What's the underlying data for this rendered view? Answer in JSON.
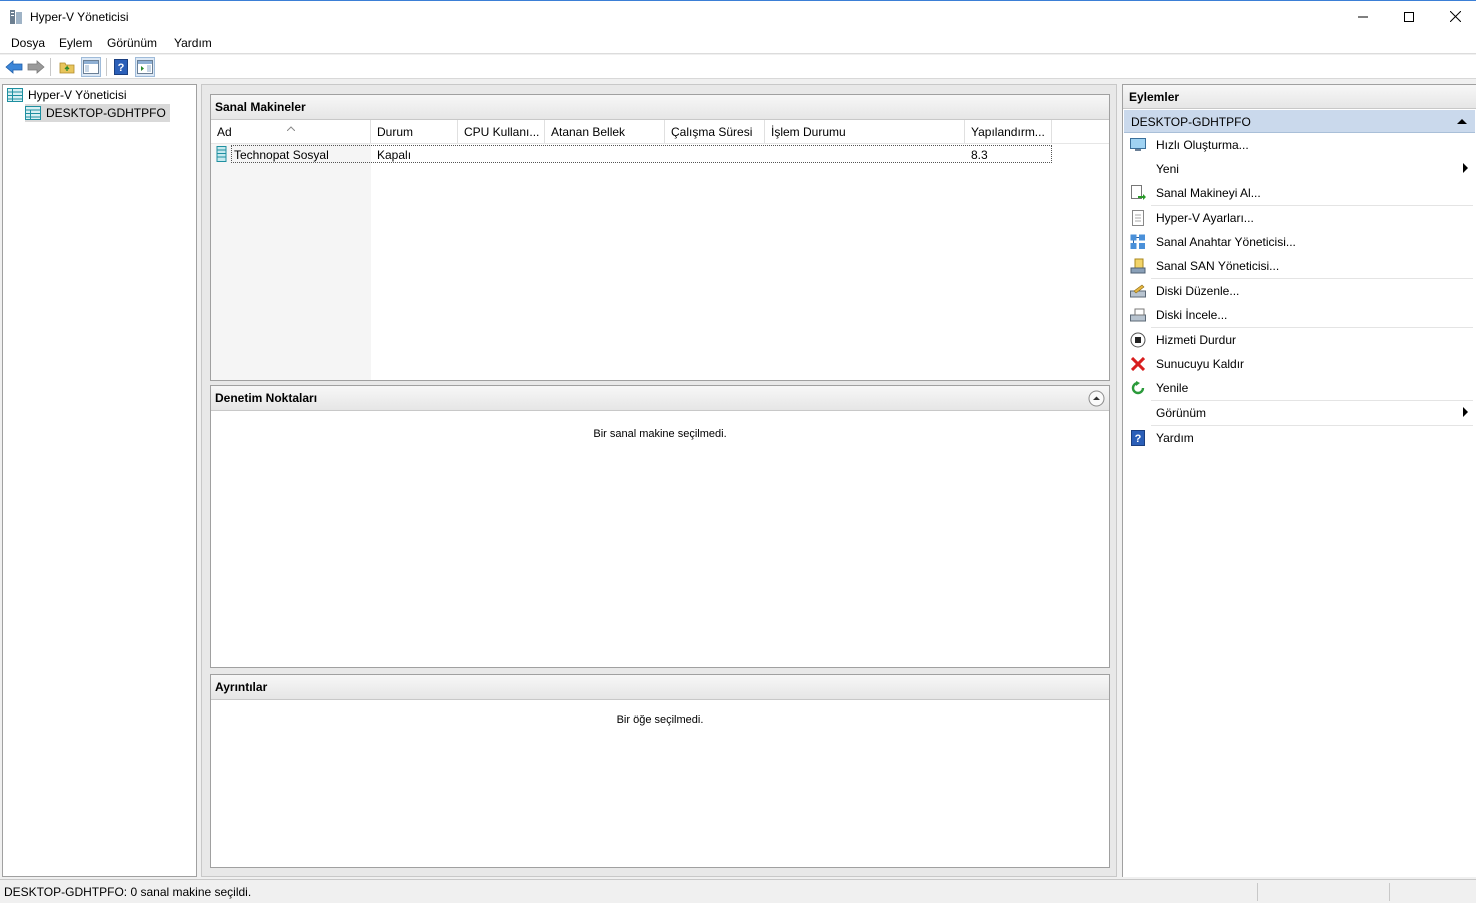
{
  "window": {
    "title": "Hyper-V Yöneticisi"
  },
  "menu": {
    "items": [
      "Dosya",
      "Eylem",
      "Görünüm",
      "Yardım"
    ]
  },
  "tree": {
    "root": "Hyper-V Yöneticisi",
    "host": "DESKTOP-GDHTPFO"
  },
  "vms": {
    "title": "Sanal Makineler",
    "columns": [
      "Ad",
      "Durum",
      "CPU Kullanı...",
      "Atanan Bellek",
      "Çalışma Süresi",
      "İşlem Durumu",
      "Yapılandırm..."
    ],
    "rows": [
      {
        "name": "Technopat Sosyal",
        "state": "Kapalı",
        "cpu": "",
        "memory": "",
        "uptime": "",
        "status": "",
        "version": "8.3"
      }
    ]
  },
  "checkpoints": {
    "title": "Denetim Noktaları",
    "empty": "Bir sanal makine seçilmedi."
  },
  "details": {
    "title": "Ayrıntılar",
    "empty": "Bir öğe seçilmedi."
  },
  "actions": {
    "title": "Eylemler",
    "section": "DESKTOP-GDHTPFO",
    "items": [
      {
        "label": "Hızlı Oluşturma...",
        "icon": "quick-create-icon"
      },
      {
        "label": "Yeni",
        "icon": "none",
        "submenu": true
      },
      {
        "label": "Sanal Makineyi Al...",
        "icon": "import-vm-icon"
      },
      {
        "label": "Hyper-V Ayarları...",
        "icon": "settings-icon"
      },
      {
        "label": "Sanal Anahtar Yöneticisi...",
        "icon": "switch-manager-icon"
      },
      {
        "label": "Sanal SAN Yöneticisi...",
        "icon": "san-manager-icon"
      },
      {
        "label": "Diski Düzenle...",
        "icon": "edit-disk-icon"
      },
      {
        "label": "Diski İncele...",
        "icon": "inspect-disk-icon"
      },
      {
        "label": "Hizmeti Durdur",
        "icon": "stop-service-icon"
      },
      {
        "label": "Sunucuyu Kaldır",
        "icon": "remove-server-icon"
      },
      {
        "label": "Yenile",
        "icon": "refresh-icon"
      },
      {
        "label": "Görünüm",
        "icon": "none",
        "submenu": true
      },
      {
        "label": "Yardım",
        "icon": "help-icon"
      }
    ]
  },
  "status": {
    "text": "DESKTOP-GDHTPFO:  0 sanal makine seçildi."
  },
  "colors": {
    "selection": "#cad9ec",
    "accent": "#3b7fd6"
  }
}
